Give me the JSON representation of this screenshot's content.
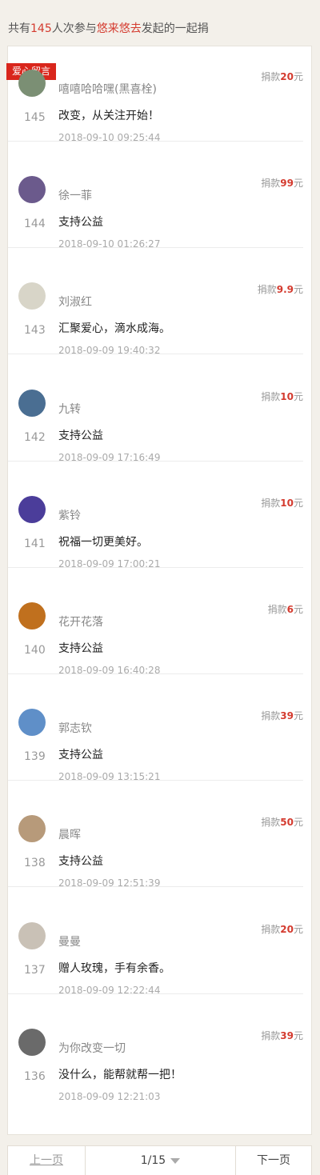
{
  "header": {
    "prefix": "共有",
    "count": "145",
    "mid": "人次参与",
    "organizer": "悠来悠去",
    "suffix": "发起的一起捐"
  },
  "tag": "爱心留言",
  "amount_prefix": "捐款",
  "amount_suffix": "元",
  "items": [
    {
      "name": "嘻嘻哈哈嘿(黑喜栓)",
      "amount": "20",
      "rank": "145",
      "message": "改变，从关注开始！",
      "time": "2018-09-10 09:25:44",
      "avatar_color": "#7b8f74"
    },
    {
      "name": "徐一菲",
      "amount": "99",
      "rank": "144",
      "message": "支持公益",
      "time": "2018-09-10 01:26:27",
      "avatar_color": "#6b5a8c"
    },
    {
      "name": "刘淑红",
      "amount": "9.9",
      "rank": "143",
      "message": "汇聚爱心，滴水成海。",
      "time": "2018-09-09 19:40:32",
      "avatar_color": "#d8d5c8"
    },
    {
      "name": "九转",
      "amount": "10",
      "rank": "142",
      "message": "支持公益",
      "time": "2018-09-09 17:16:49",
      "avatar_color": "#4a6e92"
    },
    {
      "name": "紫铃",
      "amount": "10",
      "rank": "141",
      "message": "祝福一切更美好。",
      "time": "2018-09-09 17:00:21",
      "avatar_color": "#4b3d9a"
    },
    {
      "name": "花开花落",
      "amount": "6",
      "rank": "140",
      "message": "支持公益",
      "time": "2018-09-09 16:40:28",
      "avatar_color": "#c0701e"
    },
    {
      "name": "郭志钦",
      "amount": "39",
      "rank": "139",
      "message": "支持公益",
      "time": "2018-09-09 13:15:21",
      "avatar_color": "#5f8fc8"
    },
    {
      "name": "晨晖",
      "amount": "50",
      "rank": "138",
      "message": "支持公益",
      "time": "2018-09-09 12:51:39",
      "avatar_color": "#b79a7a"
    },
    {
      "name": "曼曼",
      "amount": "20",
      "rank": "137",
      "message": "赠人玫瑰，手有余香。",
      "time": "2018-09-09 12:22:44",
      "avatar_color": "#c9c1b6"
    },
    {
      "name": "为你改变一切",
      "amount": "39",
      "rank": "136",
      "message": "没什么，能帮就帮一把！",
      "time": "2018-09-09 12:21:03",
      "avatar_color": "#6a6a6a"
    }
  ],
  "pager": {
    "prev": "上一页",
    "page": "1/15",
    "next": "下一页"
  }
}
